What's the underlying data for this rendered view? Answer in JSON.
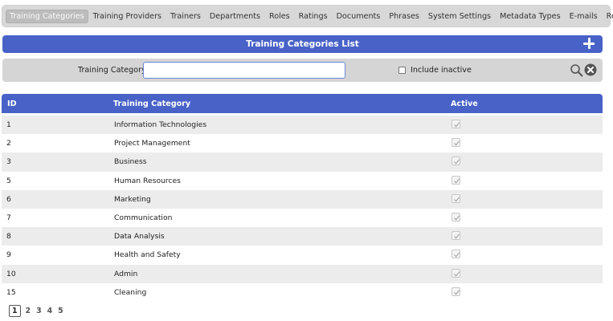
{
  "nav": {
    "tabs": [
      {
        "label": "Training Categories",
        "active": true
      },
      {
        "label": "Training Providers",
        "active": false
      },
      {
        "label": "Trainers",
        "active": false
      },
      {
        "label": "Departments",
        "active": false
      },
      {
        "label": "Roles",
        "active": false
      },
      {
        "label": "Ratings",
        "active": false
      },
      {
        "label": "Documents",
        "active": false
      },
      {
        "label": "Phrases",
        "active": false
      },
      {
        "label": "System Settings",
        "active": false
      },
      {
        "label": "Metadata Types",
        "active": false
      },
      {
        "label": "E-mails",
        "active": false
      },
      {
        "label": "Reasons",
        "active": false
      }
    ]
  },
  "list": {
    "title": "Training Categories List",
    "add_icon": "plus-icon"
  },
  "filter": {
    "label": "Training Category",
    "value": "",
    "placeholder": "",
    "include_inactive_label": "Include inactive",
    "include_inactive_checked": false,
    "search_icon": "search-icon",
    "clear_icon": "clear-icon"
  },
  "table": {
    "headers": {
      "id": "ID",
      "category": "Training Category",
      "active": "Active"
    },
    "rows": [
      {
        "id": "1",
        "category": "Information Technologies",
        "active": true
      },
      {
        "id": "2",
        "category": "Project Management",
        "active": true
      },
      {
        "id": "3",
        "category": "Business",
        "active": true
      },
      {
        "id": "5",
        "category": "Human Resources",
        "active": true
      },
      {
        "id": "6",
        "category": "Marketing",
        "active": true
      },
      {
        "id": "7",
        "category": "Communication",
        "active": true
      },
      {
        "id": "8",
        "category": "Data Analysis",
        "active": true
      },
      {
        "id": "9",
        "category": "Health and Safety",
        "active": true
      },
      {
        "id": "10",
        "category": "Admin",
        "active": true
      },
      {
        "id": "15",
        "category": "Cleaning",
        "active": true
      }
    ]
  },
  "pagination": {
    "pages": [
      "1",
      "2",
      "3",
      "4",
      "5"
    ],
    "current": "1"
  },
  "colors": {
    "accent": "#4862c8",
    "nav_bg": "#d8d8d8",
    "row_alt": "#ececec"
  }
}
